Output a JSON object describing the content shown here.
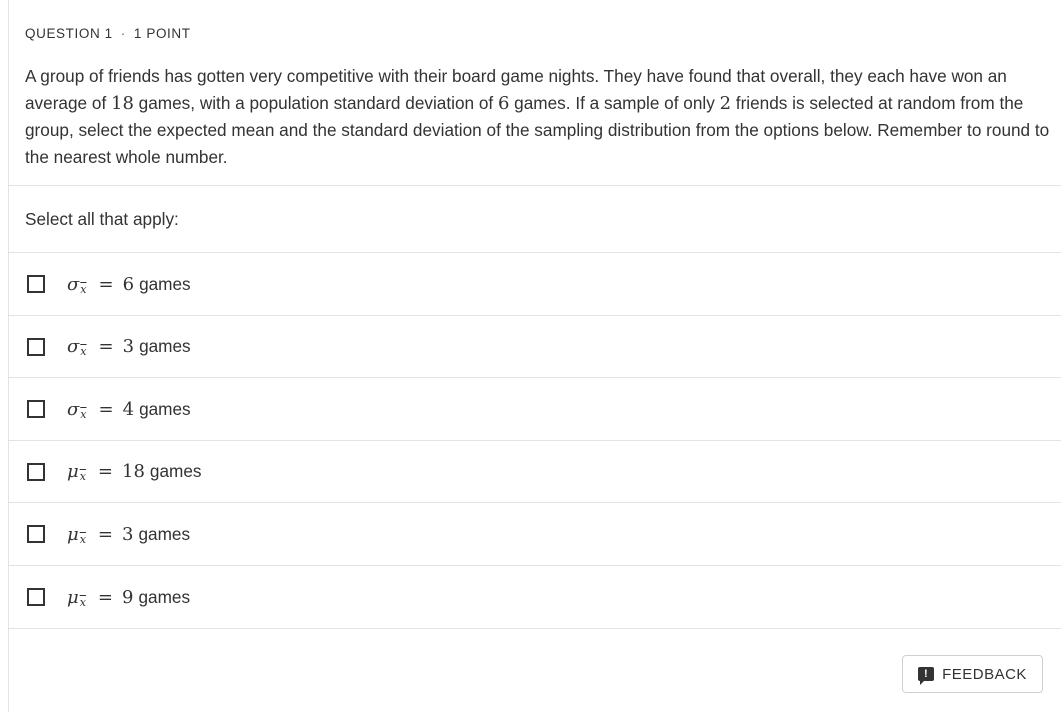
{
  "header": {
    "question_label": "QUESTION 1",
    "separator": "·",
    "points": "1 POINT"
  },
  "question": {
    "part1": "A group of friends has gotten very competitive with their board game nights. They have found that overall, they each have won an average of ",
    "mean": "18",
    "part2": " games, with a population standard deviation of ",
    "sd": "6",
    "part3": " games. If a sample of only ",
    "n": "2",
    "part4": " friends is selected at random from the group, select the expected mean and the standard deviation of the sampling distribution from the options below. Remember to round to the nearest whole number."
  },
  "instruction": "Select all that apply:",
  "options": [
    {
      "symbol": "σ",
      "subscript": "x",
      "equals": "=",
      "value": "6",
      "unit": "games",
      "checked": false
    },
    {
      "symbol": "σ",
      "subscript": "x",
      "equals": "=",
      "value": "3",
      "unit": "games",
      "checked": false
    },
    {
      "symbol": "σ",
      "subscript": "x",
      "equals": "=",
      "value": "4",
      "unit": "games",
      "checked": false
    },
    {
      "symbol": "μ",
      "subscript": "x",
      "equals": "=",
      "value": "18",
      "unit": "games",
      "checked": false
    },
    {
      "symbol": "μ",
      "subscript": "x",
      "equals": "=",
      "value": "3",
      "unit": "games",
      "checked": false
    },
    {
      "symbol": "μ",
      "subscript": "x",
      "equals": "=",
      "value": "9",
      "unit": "games",
      "checked": false
    }
  ],
  "feedback": {
    "icon": "feedback-icon",
    "label": "FEEDBACK"
  }
}
